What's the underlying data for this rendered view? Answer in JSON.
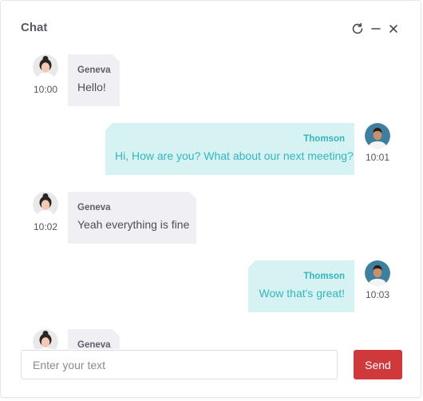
{
  "window": {
    "title": "Chat",
    "refresh_icon": "refresh-icon",
    "minimize_icon": "minimize-icon",
    "close_icon": "close-icon"
  },
  "messages": [
    {
      "sender": "Geneva",
      "text": "Hello!",
      "time": "10:00",
      "direction": "incoming"
    },
    {
      "sender": "Thomson",
      "text": "Hi, How are you? What about our next meeting?",
      "time": "10:01",
      "direction": "outgoing"
    },
    {
      "sender": "Geneva",
      "text": "Yeah everything is fine",
      "time": "10:02",
      "direction": "incoming"
    },
    {
      "sender": "Thomson",
      "text": "Wow that's great!",
      "time": "10:03",
      "direction": "outgoing"
    },
    {
      "sender": "Geneva",
      "text": "",
      "time": "",
      "direction": "incoming"
    }
  ],
  "composer": {
    "placeholder": "Enter your text",
    "send_label": "Send"
  },
  "colors": {
    "send_button": "#d0393b",
    "outgoing_bubble": "#d6f2f3",
    "outgoing_text": "#35b5bb",
    "incoming_bubble": "#f0f0f4"
  }
}
